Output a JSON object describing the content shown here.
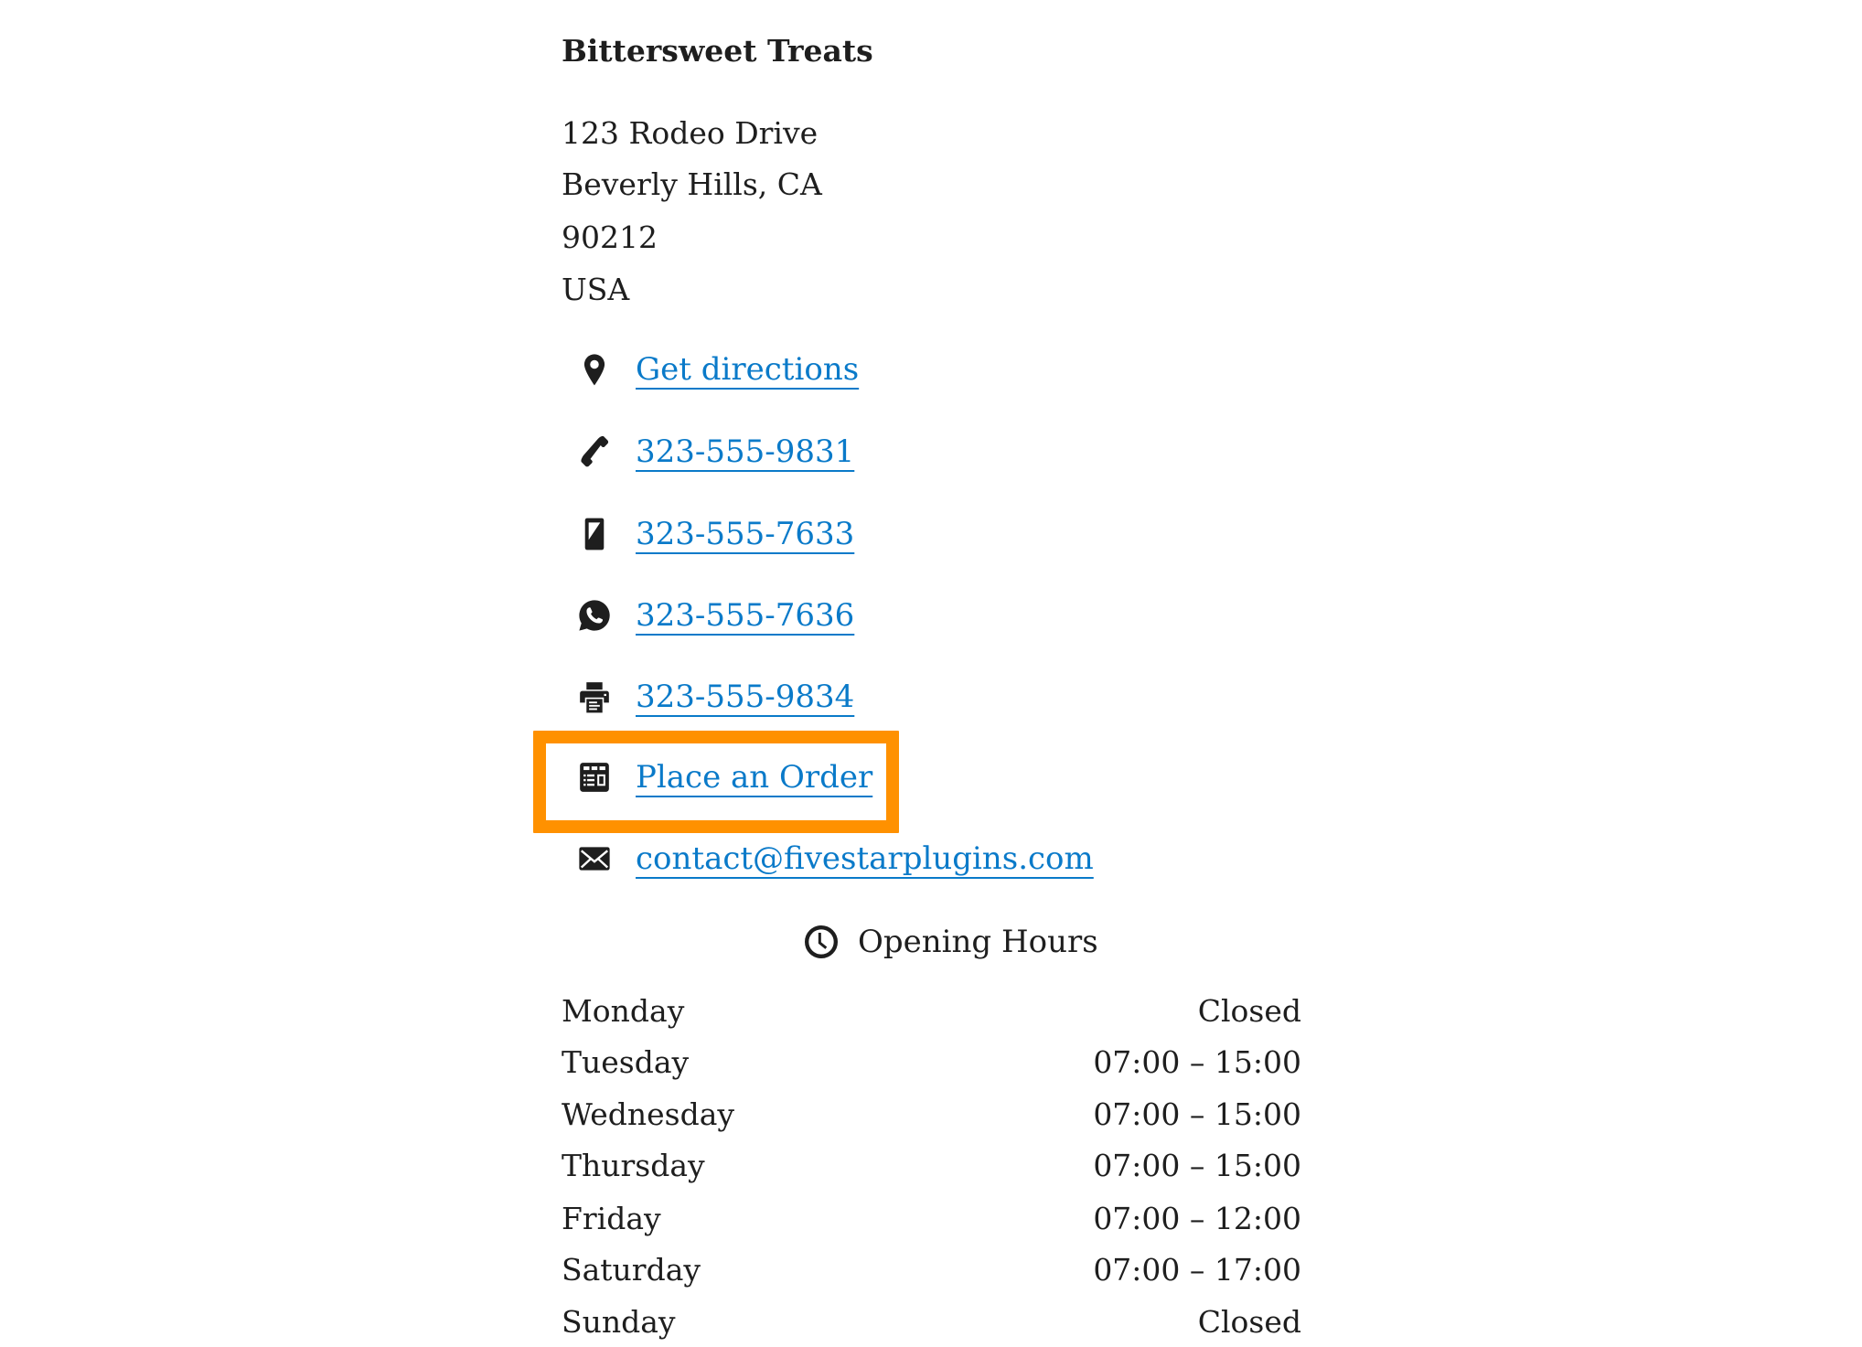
{
  "business": {
    "name": "Bittersweet Treats",
    "address_lines": [
      "123 Rodeo Drive",
      "Beverly Hills, CA",
      "90212",
      "USA"
    ]
  },
  "contact_links": [
    {
      "icon": "map-pin-icon",
      "label": "Get directions"
    },
    {
      "icon": "phone-icon",
      "label": "323-555-9831"
    },
    {
      "icon": "mobile-phone-icon",
      "label": "323-555-7633"
    },
    {
      "icon": "whatsapp-icon",
      "label": "323-555-7636"
    },
    {
      "icon": "fax-printer-icon",
      "label": "323-555-9834"
    },
    {
      "icon": "order-form-icon",
      "label": "Place an Order"
    },
    {
      "icon": "envelope-icon",
      "label": "contact@fivestarplugins.com"
    }
  ],
  "highlight": {
    "target": "Place an Order",
    "color": "#ff9100"
  },
  "colors": {
    "link": "#0a7ac9",
    "text": "#1e1e1e"
  },
  "opening_hours": {
    "icon": "clock-icon",
    "heading": "Opening Hours",
    "days": [
      {
        "day": "Monday",
        "hours": "Closed"
      },
      {
        "day": "Tuesday",
        "hours": "07:00 – 15:00"
      },
      {
        "day": "Wednesday",
        "hours": "07:00 – 15:00"
      },
      {
        "day": "Thursday",
        "hours": "07:00 – 15:00"
      },
      {
        "day": "Friday",
        "hours": "07:00 – 12:00"
      },
      {
        "day": "Saturday",
        "hours": "07:00 – 17:00"
      },
      {
        "day": "Sunday",
        "hours": "Closed"
      }
    ]
  }
}
